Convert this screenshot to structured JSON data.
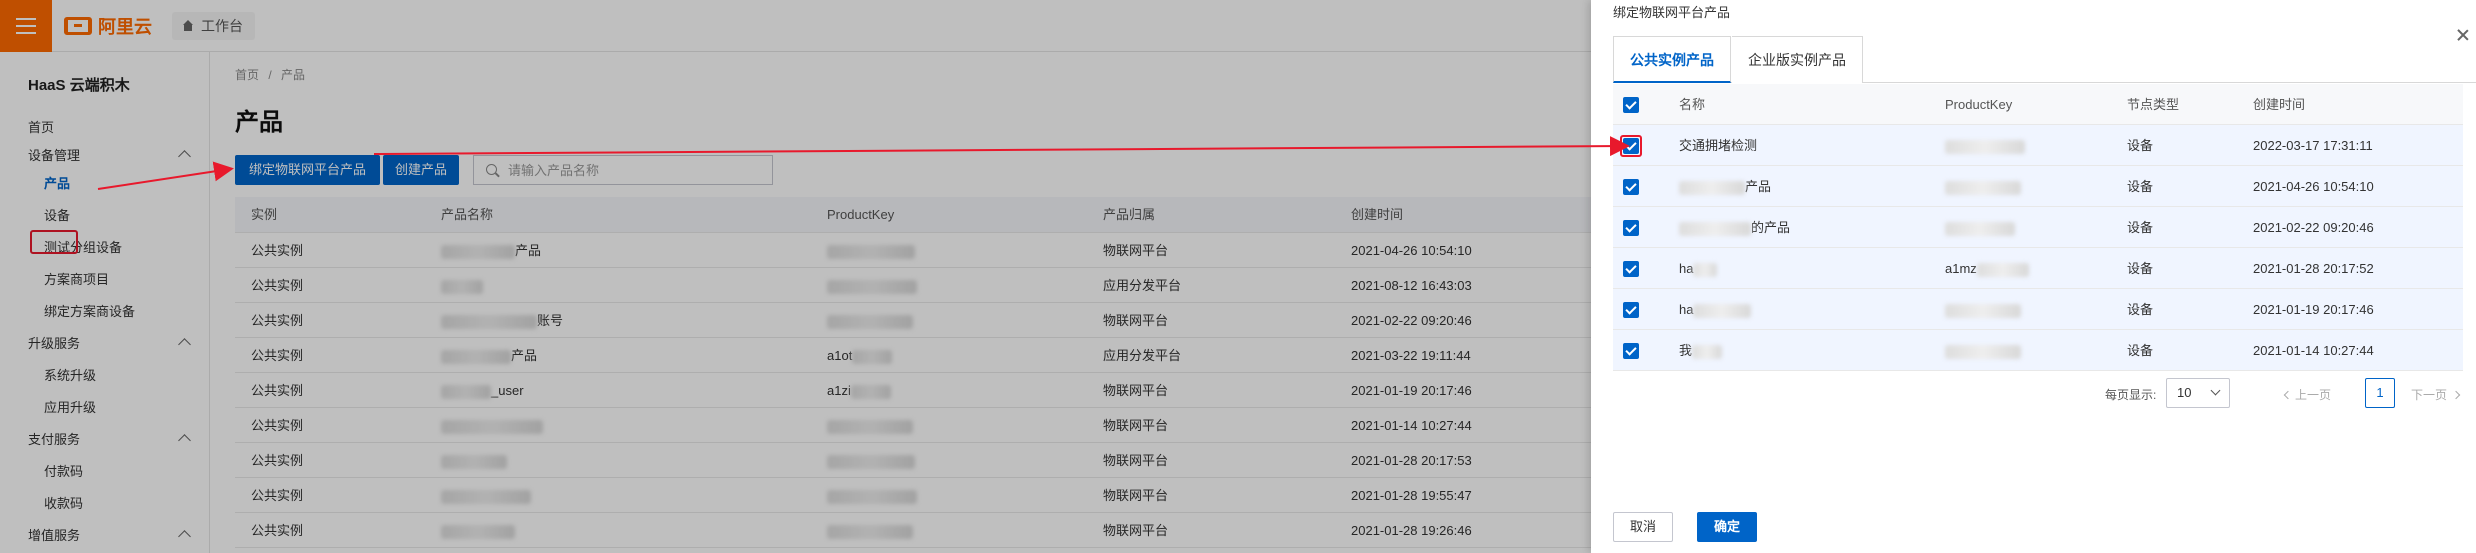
{
  "topbar": {
    "brand": "阿里云",
    "workbench": "工作台"
  },
  "sidebar": {
    "title": "HaaS 云端积木",
    "home": "首页",
    "device_mgmt": "设备管理",
    "product": "产品",
    "device": "设备",
    "test_group": "测试分组设备",
    "solution_project": "方案商项目",
    "bind_solution": "绑定方案商设备",
    "upgrade": "升级服务",
    "sys_upgrade": "系统升级",
    "app_upgrade": "应用升级",
    "payment": "支付服务",
    "pay_code": "付款码",
    "collect_code": "收款码",
    "value_added": "增值服务"
  },
  "main": {
    "breadcrumb": [
      "首页",
      "/",
      "产品"
    ],
    "title": "产品",
    "bind_btn": "绑定物联网平台产品",
    "create_btn": "创建产品",
    "search_placeholder": "请输入产品名称",
    "columns": [
      "实例",
      "产品名称",
      "ProductKey",
      "产品归属",
      "创建时间"
    ],
    "rows": [
      {
        "instance": "公共实例",
        "name_tail": "产品",
        "key": "",
        "owner": "物联网平台",
        "time": "2021-04-26 10:54:10"
      },
      {
        "instance": "公共实例",
        "name_tail": "",
        "key": "",
        "owner": "应用分发平台",
        "time": "2021-08-12 16:43:03"
      },
      {
        "instance": "公共实例",
        "name_tail": "账号",
        "key": "",
        "owner": "物联网平台",
        "time": "2021-02-22 09:20:46"
      },
      {
        "instance": "公共实例",
        "name_tail": "产品",
        "key": "a1ot",
        "owner": "应用分发平台",
        "time": "2021-03-22 19:11:44"
      },
      {
        "instance": "公共实例",
        "name_tail": "_user",
        "key": "a1zi",
        "owner": "物联网平台",
        "time": "2021-01-19 20:17:46"
      },
      {
        "instance": "公共实例",
        "name_tail": "",
        "key": "",
        "owner": "物联网平台",
        "time": "2021-01-14 10:27:44"
      },
      {
        "instance": "公共实例",
        "name_tail": "",
        "key": "",
        "owner": "物联网平台",
        "time": "2021-01-28 20:17:53"
      },
      {
        "instance": "公共实例",
        "name_tail": "",
        "key": "",
        "owner": "物联网平台",
        "time": "2021-01-28 19:55:47"
      },
      {
        "instance": "公共实例",
        "name_tail": "",
        "key": "",
        "owner": "物联网平台",
        "time": "2021-01-28 19:26:46"
      }
    ]
  },
  "drawer": {
    "title": "绑定物联网平台产品",
    "tabs": [
      "公共实例产品",
      "企业版实例产品"
    ],
    "columns": [
      "名称",
      "ProductKey",
      "节点类型",
      "创建时间"
    ],
    "rows": [
      {
        "name": "交通拥堵检测",
        "key": "",
        "type": "设备",
        "time": "2022-03-17 17:31:11"
      },
      {
        "name": "产品",
        "key": "",
        "type": "设备",
        "time": "2021-04-26 10:54:10"
      },
      {
        "name": "的产品",
        "key": "",
        "type": "设备",
        "time": "2021-02-22 09:20:46"
      },
      {
        "name": "ha",
        "key": "a1mz",
        "type": "设备",
        "time": "2021-01-28 20:17:52"
      },
      {
        "name": "ha",
        "key": "",
        "type": "设备",
        "time": "2021-01-19 20:17:46"
      },
      {
        "name": "我",
        "key": "",
        "type": "设备",
        "time": "2021-01-14 10:27:44"
      }
    ],
    "pager": {
      "label": "每页显示:",
      "size": "10",
      "prev": "上一页",
      "page": "1",
      "next": "下一页"
    },
    "cancel": "取消",
    "confirm": "确定"
  },
  "colors": {
    "primary": "#0064c8",
    "brand": "#ff6a00",
    "annotation": "#e8192c"
  }
}
